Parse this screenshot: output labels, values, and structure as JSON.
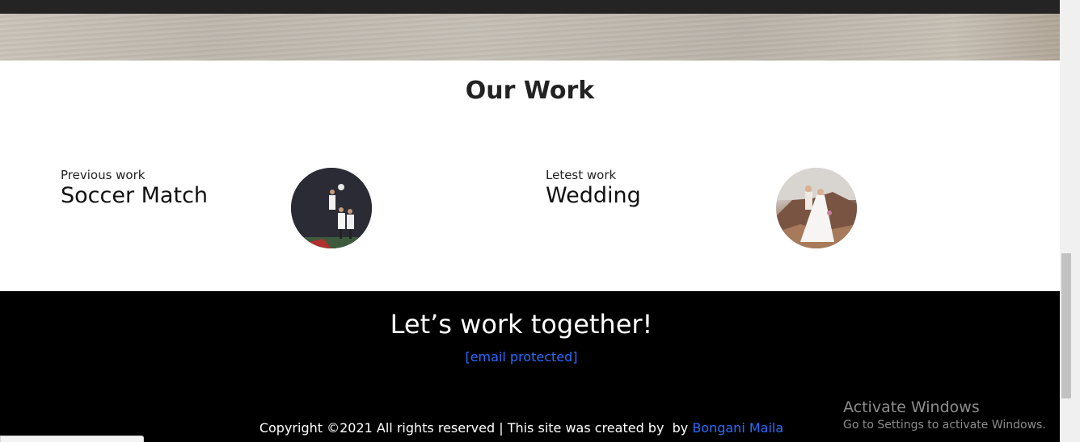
{
  "work": {
    "title": "Our Work",
    "items": [
      {
        "subtitle": "Previous work",
        "name": "Soccer Match",
        "thumb_icon": "soccer-photo"
      },
      {
        "subtitle": "Letest work",
        "name": "Wedding",
        "thumb_icon": "wedding-photo"
      }
    ]
  },
  "footer": {
    "title": "Let’s work together!",
    "email": "[email protected]",
    "copyright_text": "Copyright ©2021 All rights reserved | This site was created by  by ",
    "author": "Bongani Maila"
  },
  "overlay": {
    "activate_title": "Activate Windows",
    "activate_sub": "Go to Settings to activate Windows."
  },
  "colors": {
    "footer_bg": "#000000",
    "link": "#2d6bff",
    "top_bar": "#242424"
  }
}
